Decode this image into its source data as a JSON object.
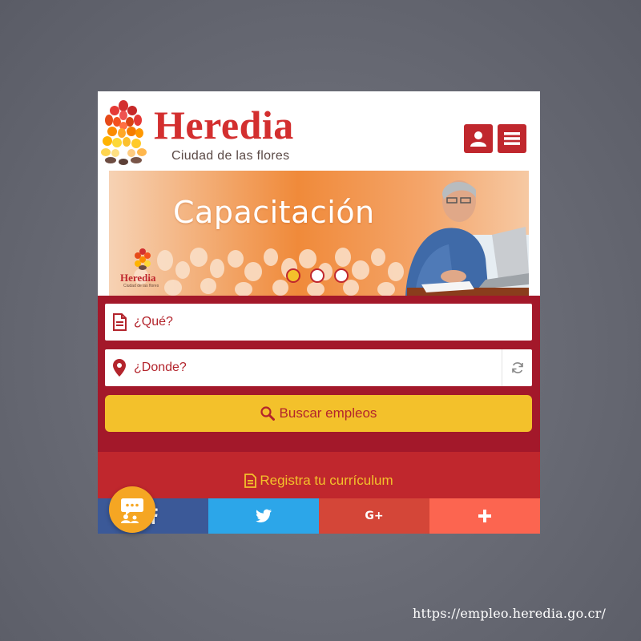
{
  "brand": {
    "title": "Heredia",
    "subtitle": "Ciudad de las flores"
  },
  "header": {
    "user_icon": "user-icon",
    "menu_icon": "hamburger-menu-icon"
  },
  "slider": {
    "title": "Capacitación",
    "mini_brand": "Heredia",
    "mini_brand_sub": "Ciudad de las flores",
    "active_slide": 1,
    "slide_count": 3
  },
  "search": {
    "what_placeholder": "¿Qué?",
    "where_placeholder": "¿Donde?",
    "button_label": "Buscar empleos"
  },
  "register": {
    "label": "Registra tu currículum"
  },
  "share": {
    "items": [
      {
        "name": "facebook",
        "icon": "facebook-icon"
      },
      {
        "name": "twitter",
        "icon": "twitter-icon"
      },
      {
        "name": "google-plus",
        "icon": "google-plus-icon",
        "text": "G+"
      },
      {
        "name": "more",
        "icon": "plus-icon"
      }
    ]
  },
  "chat": {
    "icon": "chat-support-icon"
  },
  "footer": {
    "url": "https://empleo.heredia.go.cr/"
  },
  "colors": {
    "brand_red": "#c0272d",
    "dark_red": "#a3182a",
    "yellow": "#f3c12b",
    "facebook": "#3b5998",
    "twitter": "#2ca6e9",
    "google_plus": "#d44638",
    "more": "#fc6550",
    "chat": "#f5a623"
  }
}
